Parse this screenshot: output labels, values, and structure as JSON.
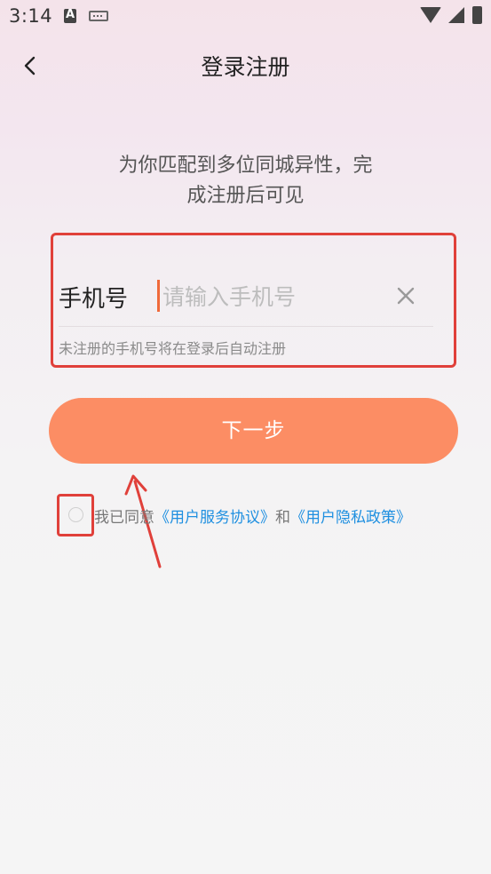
{
  "status_bar": {
    "time": "3:14"
  },
  "header": {
    "title": "登录注册",
    "back_icon": "chevron-left-icon"
  },
  "subtitle": {
    "line1": "为你匹配到多位同城异性，完",
    "line2": "成注册后可见"
  },
  "phone": {
    "label": "手机号",
    "value": "",
    "placeholder": "请输入手机号",
    "clear_icon": "close-icon",
    "hint": "未注册的手机号将在登录后自动注册"
  },
  "next_button": {
    "label": "下一步"
  },
  "agreement": {
    "checked": false,
    "prefix": "我已同意",
    "link_service": "《用户服务协议》",
    "conjunction": "和",
    "link_privacy": "《用户隐私政策》"
  },
  "colors": {
    "accent": "#fc8d64",
    "link": "#1e8fe0",
    "annotation": "#e0403a",
    "cursor": "#f06a3a"
  }
}
